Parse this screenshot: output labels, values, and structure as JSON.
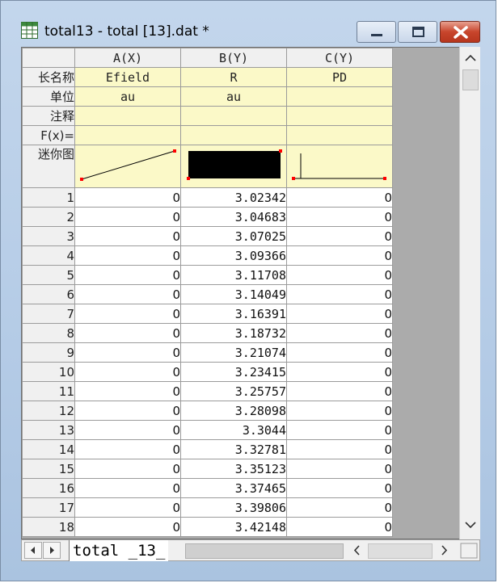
{
  "window": {
    "title": "total13 - total [13].dat *",
    "icon": "worksheet-icon"
  },
  "columns": [
    {
      "header": "A(X)",
      "long_name": "Efield",
      "units": "au",
      "comments": "",
      "fx": ""
    },
    {
      "header": "B(Y)",
      "long_name": "R",
      "units": "au",
      "comments": "",
      "fx": ""
    },
    {
      "header": "C(Y)",
      "long_name": "PD",
      "units": "",
      "comments": "",
      "fx": ""
    }
  ],
  "row_labels": {
    "long_name": "长名称",
    "units": "单位",
    "comments": "注释",
    "fx": "F(x)=",
    "sparkline": "迷你图"
  },
  "rows": [
    {
      "n": "1",
      "a": "0",
      "b": "3.02342",
      "c": "0"
    },
    {
      "n": "2",
      "a": "0",
      "b": "3.04683",
      "c": "0"
    },
    {
      "n": "3",
      "a": "0",
      "b": "3.07025",
      "c": "0"
    },
    {
      "n": "4",
      "a": "0",
      "b": "3.09366",
      "c": "0"
    },
    {
      "n": "5",
      "a": "0",
      "b": "3.11708",
      "c": "0"
    },
    {
      "n": "6",
      "a": "0",
      "b": "3.14049",
      "c": "0"
    },
    {
      "n": "7",
      "a": "0",
      "b": "3.16391",
      "c": "0"
    },
    {
      "n": "8",
      "a": "0",
      "b": "3.18732",
      "c": "0"
    },
    {
      "n": "9",
      "a": "0",
      "b": "3.21074",
      "c": "0"
    },
    {
      "n": "10",
      "a": "0",
      "b": "3.23415",
      "c": "0"
    },
    {
      "n": "11",
      "a": "0",
      "b": "3.25757",
      "c": "0"
    },
    {
      "n": "12",
      "a": "0",
      "b": "3.28098",
      "c": "0"
    },
    {
      "n": "13",
      "a": "0",
      "b": "3.3044",
      "c": "0"
    },
    {
      "n": "14",
      "a": "0",
      "b": "3.32781",
      "c": "0"
    },
    {
      "n": "15",
      "a": "0",
      "b": "3.35123",
      "c": "0"
    },
    {
      "n": "16",
      "a": "0",
      "b": "3.37465",
      "c": "0"
    },
    {
      "n": "17",
      "a": "0",
      "b": "3.39806",
      "c": "0"
    },
    {
      "n": "18",
      "a": "0",
      "b": "3.42148",
      "c": "0"
    }
  ],
  "sheet_tab": {
    "label": "total _13_"
  },
  "colors": {
    "meta_row_bg": "#fbf9c8",
    "header_bg": "#f0f0f0",
    "sparkline": "#000000",
    "sparkline_endpoint": "#ff0000",
    "close_button": "#c8452c"
  }
}
